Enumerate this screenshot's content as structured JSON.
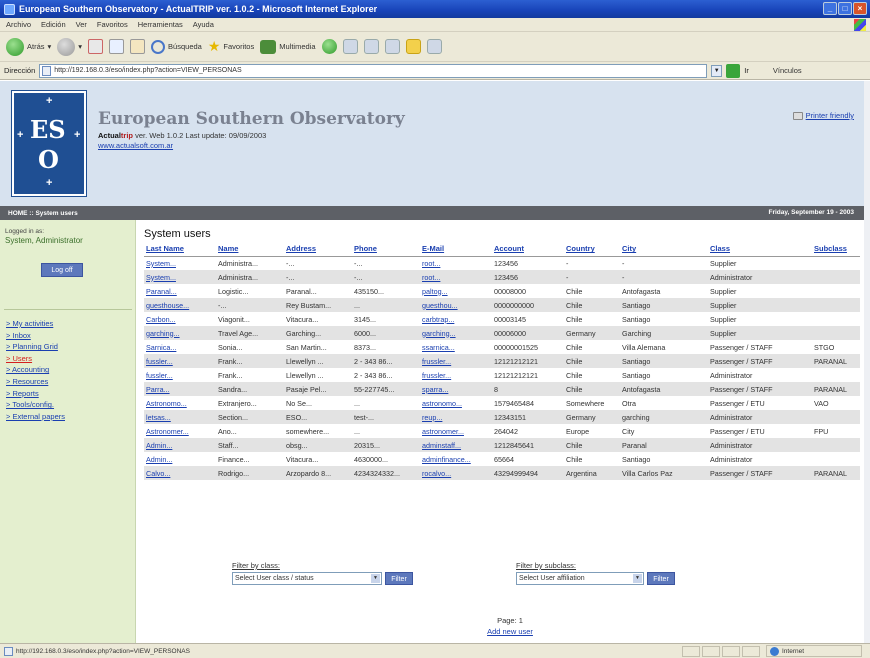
{
  "window": {
    "title": "European Southern Observatory - ActualTRIP ver. 1.0.2 - Microsoft Internet Explorer"
  },
  "menubar": [
    "Archivo",
    "Edición",
    "Ver",
    "Favoritos",
    "Herramientas",
    "Ayuda"
  ],
  "toolbar": {
    "back": "Atrás",
    "search": "Búsqueda",
    "favorites": "Favoritos",
    "multimedia": "Multimedia"
  },
  "address": {
    "label": "Dirección",
    "url": "http://192.168.0.3/eso/index.php?action=VIEW_PERSONAS",
    "go": "Ir",
    "links": "Vínculos"
  },
  "header": {
    "org": "European Southern Observatory",
    "product_a": "Actual",
    "product_b": "trip",
    "version": " ver. Web 1.0.2 Last update: 09/09/2003",
    "site": "www.actualsoft.com.ar",
    "printer_friendly": "Printer friendly",
    "logo_es": "ES",
    "logo_o": "O"
  },
  "navbar": {
    "breadcrumb": "HOME :: System users",
    "date": "Friday, September 19 - 2003"
  },
  "sidebar": {
    "logged_label": "Logged in as:",
    "logged_user": "System, Administrator",
    "logoff": "Log off",
    "menu": [
      "> My activities",
      "> Inbox",
      "> Planning Grid",
      "> Users",
      "> Accounting",
      "> Resources",
      "> Reports",
      "> Tools/config.",
      "> External papers"
    ],
    "current": 3
  },
  "main": {
    "title": "System users",
    "columns": [
      "Last Name",
      "Name",
      "Address",
      "Phone",
      "E-Mail",
      "Account",
      "Country",
      "City",
      "Class",
      "Subclass"
    ],
    "rows": [
      [
        "System...",
        "Administra...",
        "-...",
        "-...",
        "root...",
        "123456",
        "-",
        "-",
        "Supplier",
        ""
      ],
      [
        "System...",
        "Administra...",
        "-...",
        "-...",
        "root...",
        "123456",
        "-",
        "-",
        "Administrator",
        ""
      ],
      [
        "Paranal...",
        "Logistic...",
        "Paranal...",
        "435150...",
        "paltog...",
        "00008000",
        "Chile",
        "Antofagasta",
        "Supplier",
        ""
      ],
      [
        "guesthouse...",
        "-...",
        "Rey Bustam...",
        "...",
        "guesthou...",
        "0000000000",
        "Chile",
        "Santiago",
        "Supplier",
        ""
      ],
      [
        "Carbon...",
        "Viagonit...",
        "Vitacura...",
        "3145...",
        "carbtrap...",
        "00003145",
        "Chile",
        "Santiago",
        "Supplier",
        ""
      ],
      [
        "garching...",
        "Travel Age...",
        "Garching...",
        "6000...",
        "garching...",
        "00006000",
        "Germany",
        "Garching",
        "Supplier",
        ""
      ],
      [
        "Sarnica...",
        "Sonia...",
        "San Martin...",
        "8373...",
        "ssarnica...",
        "00000001525",
        "Chile",
        "Villa Alemana",
        "Passenger / STAFF",
        "STGO"
      ],
      [
        "fussler...",
        "Frank...",
        "Llewellyn ...",
        "2 - 343 86...",
        "frussler...",
        "12121212121",
        "Chile",
        "Santiago",
        "Passenger / STAFF",
        "PARANAL"
      ],
      [
        "fussler...",
        "Frank...",
        "Llewellyn ...",
        "2 - 343 86...",
        "frussler...",
        "12121212121",
        "Chile",
        "Santiago",
        "Administrator",
        ""
      ],
      [
        "Parra...",
        "Sandra...",
        "Pasaje Pel...",
        "55-227745...",
        "sparra...",
        "8",
        "Chile",
        "Antofagasta",
        "Passenger / STAFF",
        "PARANAL"
      ],
      [
        "Astronomo...",
        "Extranjero...",
        "No Se...",
        "...",
        "astronomo...",
        "1579465484",
        "Somewhere",
        "Otra",
        "Passenger / ETU",
        "VAO"
      ],
      [
        "letsas...",
        "Section...",
        "ESO...",
        "test-...",
        "reup...",
        "12343151",
        "Germany",
        "garching",
        "Administrator",
        ""
      ],
      [
        "Astronomer...",
        "Ano...",
        "somewhere...",
        "...",
        "astronomer...",
        "264042",
        "Europe",
        "City",
        "Passenger / ETU",
        "FPU"
      ],
      [
        "Admin...",
        "Staff...",
        "obsg...",
        "20315...",
        "adminstaff...",
        "1212845641",
        "Chile",
        "Paranal",
        "Administrator",
        ""
      ],
      [
        "Admin...",
        "Finance...",
        "Vitacura...",
        "4630000...",
        "adminfinance...",
        "65664",
        "Chile",
        "Santiago",
        "Administrator",
        ""
      ],
      [
        "Calvo...",
        "Rodrigo...",
        "Arzopardo 8...",
        "4234324332...",
        "rocalvo...",
        "43294999494",
        "Argentina",
        "Villa Carlos Paz",
        "Passenger / STAFF",
        "PARANAL"
      ]
    ]
  },
  "filters": {
    "class_label": "Filter by class:",
    "class_value": "Select User class / status",
    "subclass_label": "Filter by subclass:",
    "subclass_value": "Select User affiliation",
    "button": "Filter"
  },
  "pager": {
    "text": "Page: 1",
    "add": "Add new user"
  },
  "status": {
    "url": "http://192.168.0.3/eso/index.php?action=VIEW_PERSONAS",
    "zone": "Internet"
  }
}
